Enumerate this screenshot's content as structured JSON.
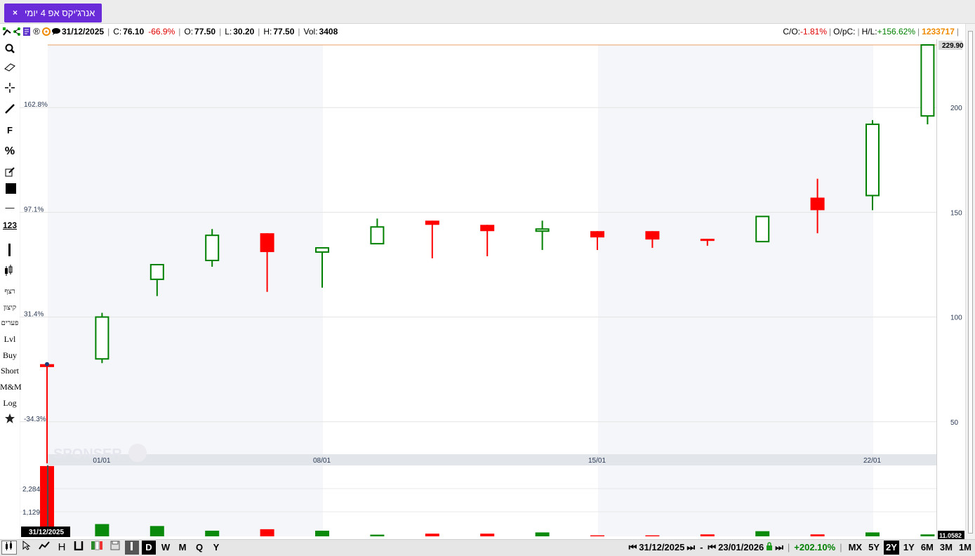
{
  "tab": {
    "title": "אנרג'יקס אפ 4 יומי",
    "close": "×"
  },
  "info": {
    "date": "31/12/2025",
    "close_label": "C:",
    "close": "76.10",
    "change": "-66.9%",
    "open_label": "O:",
    "open": "77.50",
    "low_label": "L:",
    "low": "30.20",
    "high_label": "H:",
    "high": "77.50",
    "vol_label": "Vol:",
    "vol": "3408",
    "co_label": "C/O:",
    "co": "-1.81%",
    "opc_label": "O/pC:",
    "hl_label": "H/L:",
    "hl": "+156.62%",
    "id": "1233717"
  },
  "tools": {
    "search": "search-icon",
    "eraser": "eraser-icon",
    "crosshair": "crosshair-icon",
    "line": "line-icon",
    "f": "F",
    "percent": "%",
    "edit": "edit-icon",
    "hline": "—",
    "num": "123",
    "rezef": "רצף",
    "kitzun": "קיצון",
    "paarim": "פערים",
    "lvl": "Lvl",
    "buy": "Buy",
    "short": "Short",
    "mm": "M&M",
    "log": "Log"
  },
  "colors": {
    "up": "#008000",
    "down": "#ff0000",
    "accent": "#6a2bd9"
  },
  "chart_data": {
    "type": "candlestick",
    "left_axis_ticks": [
      "162.8%",
      "97.1%",
      "31.4%",
      "-34.3%"
    ],
    "right_axis_ticks": [
      200,
      150,
      100,
      50
    ],
    "right_axis_current": "229.90",
    "x_ticks": [
      "01/01",
      "08/01",
      "15/01",
      "22/01"
    ],
    "ylim": [
      34.5,
      229.9
    ],
    "candles": [
      {
        "o": 77.5,
        "h": 77.5,
        "l": 30.2,
        "c": 76.1
      },
      {
        "o": 80,
        "h": 102,
        "l": 78,
        "c": 100
      },
      {
        "o": 118,
        "h": 124,
        "l": 110,
        "c": 125
      },
      {
        "o": 127,
        "h": 142,
        "l": 124,
        "c": 139
      },
      {
        "o": 140,
        "h": 140,
        "l": 112,
        "c": 131
      },
      {
        "o": 131,
        "h": 133,
        "l": 114,
        "c": 133
      },
      {
        "o": 135,
        "h": 147,
        "l": 136,
        "c": 143
      },
      {
        "o": 146,
        "h": 146,
        "l": 128,
        "c": 144
      },
      {
        "o": 144,
        "h": 144,
        "l": 129,
        "c": 141
      },
      {
        "o": 141,
        "h": 146,
        "l": 132,
        "c": 142
      },
      {
        "o": 141,
        "h": 141,
        "l": 132,
        "c": 138
      },
      {
        "o": 141,
        "h": 141,
        "l": 133,
        "c": 137
      },
      {
        "o": 137,
        "h": 137,
        "l": 134,
        "c": 137
      },
      {
        "o": 136,
        "h": 148,
        "l": 136,
        "c": 148
      },
      {
        "o": 157,
        "h": 166,
        "l": 140,
        "c": 151
      },
      {
        "o": 158,
        "h": 194,
        "l": 151,
        "c": 192
      },
      {
        "o": 196,
        "h": 230,
        "l": 192,
        "c": 229.9
      }
    ],
    "volume_ticks": [
      "2,284",
      "1,129"
    ],
    "volume_label": "11.0582",
    "volume": [
      3408,
      500,
      420,
      230,
      290,
      230,
      70,
      110,
      110,
      160,
      40,
      40,
      80,
      210,
      80,
      160,
      80
    ],
    "cursor_date": "31/12/2025"
  },
  "bottom": {
    "d": "D",
    "w": "W",
    "m": "M",
    "q": "Q",
    "y": "Y",
    "from_date": "31/12/2025",
    "dash": "-",
    "to_date": "23/01/2026",
    "change": "+202.10%",
    "ranges": [
      "MX",
      "5Y",
      "2Y",
      "1Y",
      "6M",
      "3M",
      "1M"
    ],
    "active_range": "2Y",
    "rewind": "⏮",
    "prev": "⏭",
    "fwd": "⏭"
  }
}
